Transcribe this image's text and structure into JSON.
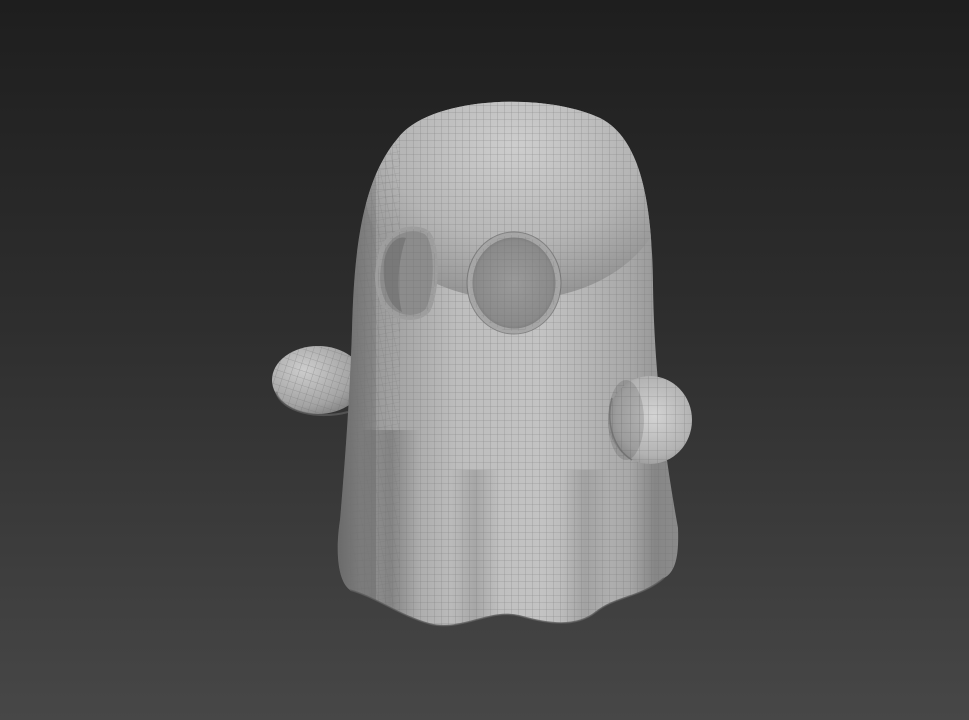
{
  "viewport": {
    "background_top": "#1e1e1e",
    "background_bottom": "#474747"
  },
  "model": {
    "name": "ghost",
    "display": "shaded-with-wireframe",
    "shade_color": "#b4b4b4",
    "wire_color": "#6e6e6e",
    "eye_hole_color": "#8a8a8a"
  }
}
